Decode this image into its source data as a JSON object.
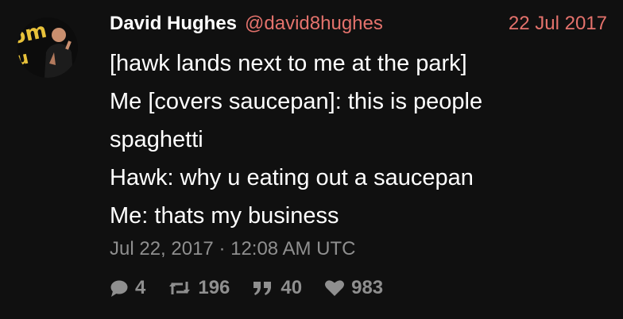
{
  "user": {
    "display_name": "David Hughes",
    "handle": "@david8hughes"
  },
  "tweet": {
    "date_short": "22 Jul 2017",
    "lines": [
      "[hawk lands next to me at the park]",
      "Me [covers saucepan]: this is people",
      "spaghetti",
      "Hawk: why u eating out a saucepan",
      "Me: thats my business"
    ],
    "timestamp": "Jul 22, 2017 · 12:08 AM UTC"
  },
  "stats": {
    "replies": "4",
    "retweets": "196",
    "quotes": "40",
    "likes": "983"
  },
  "icons": {
    "reply": "comment-icon",
    "retweet": "retweet-icon",
    "quote": "quote-icon",
    "like": "heart-icon"
  },
  "colors": {
    "background": "#101010",
    "accent": "#e4726c",
    "muted": "#8f8f8f",
    "text": "#ffffff"
  }
}
